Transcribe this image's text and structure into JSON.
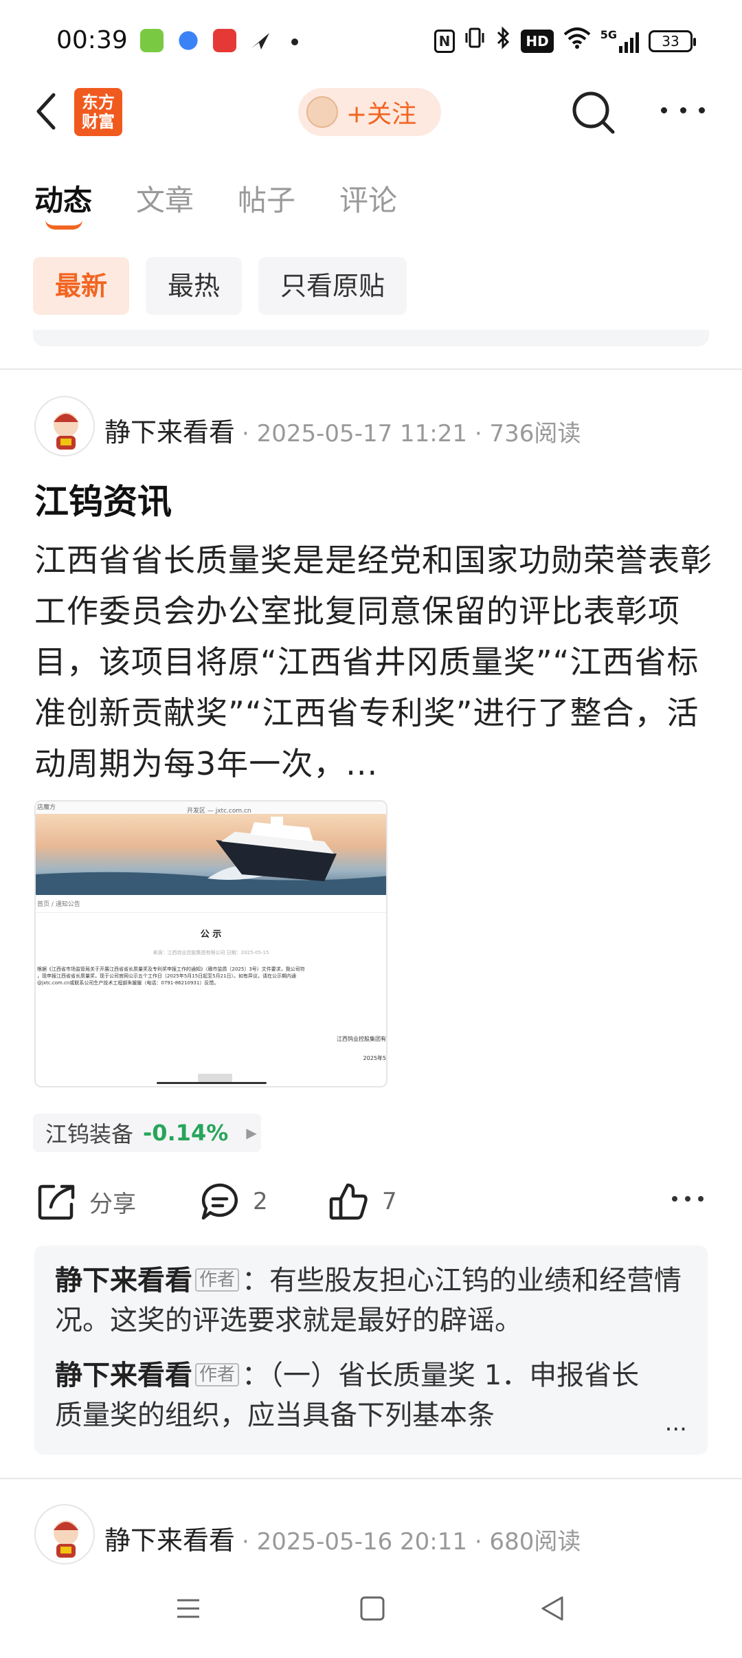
{
  "status_bar": {
    "time": "00:39",
    "nfc_icon": "N",
    "hd_label": "HD",
    "network": "5G",
    "battery": "33"
  },
  "header": {
    "logo_text": "东方财富",
    "follow_label": "+关注"
  },
  "tabs": [
    {
      "label": "动态",
      "active": true
    },
    {
      "label": "文章",
      "active": false
    },
    {
      "label": "帖子",
      "active": false
    },
    {
      "label": "评论",
      "active": false
    }
  ],
  "filters": [
    {
      "label": "最新",
      "active": true
    },
    {
      "label": "最热",
      "active": false
    },
    {
      "label": "只看原贴",
      "active": false
    }
  ],
  "post": {
    "author": "静下来看看",
    "meta": "· 2025-05-17 11:21 · 736阅读",
    "title": "江钨资讯",
    "body": "江西省省长质量奖是是经党和国家功勋荣誉表彰工作委员会办公室批复同意保留的评比表彰项目，该项目将原“江西省井冈质量奖”“江西省标准创新贡献奖”“江西省专利奖”进行了整合，活动周期为每3年一次，...",
    "image": {
      "tabs_left": "店魔方",
      "url": "开发区 — jxtc.com.cn",
      "breadcrumb": "首页 / 通知公告",
      "notice_title": "公 示",
      "source": "来源：江西钨业控股集团有限公司  日期：2025-05-15",
      "text_lines": [
        "根据《江西省市场监管局关于开展江西省省长质量奖及专利奖申报工作的通知》（赣市监质〔2025〕3号）文件要求，我公司符",
        "，现申报江西省省长质量奖，现于公司官网公示五个工作日（2025年5月15日起至5月21日）。如有异议，请在公示期内通",
        "@jxtc.com.cn或联系公司生产技术工程部朱媛媛（电话：0791-86210931）反馈。"
      ],
      "signature": "江西钨业控股集团有",
      "date": "2025年5"
    },
    "stock": {
      "name": "江钨装备",
      "change": "-0.14%"
    },
    "actions": {
      "share_label": "分享",
      "comment_count": "2",
      "like_count": "7"
    },
    "comments": [
      {
        "author": "静下来看看",
        "badge": "作者",
        "text": "：有些股友担心江钨的业绩和经营情况。这奖的评选要求就是最好的辟谣。"
      },
      {
        "author": "静下来看看",
        "badge": "作者",
        "text": "：（一）省长质量奖 1．申报省长质量奖的组织，应当具备下列基本条"
      }
    ],
    "comments_more": "..."
  },
  "next_post": {
    "author": "静下来看看",
    "meta": "· 2025-05-16 20:11 · 680阅读"
  },
  "colors": {
    "accent": "#f26522",
    "stock_green": "#27a55b"
  }
}
